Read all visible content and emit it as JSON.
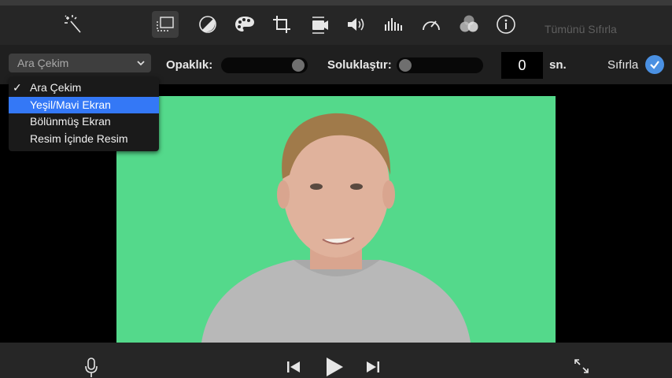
{
  "toolbar": {
    "tools": [
      {
        "name": "magic-wand-icon"
      },
      {
        "name": "video-overlay-icon",
        "active": true
      },
      {
        "name": "color-balance-icon"
      },
      {
        "name": "color-palette-icon"
      },
      {
        "name": "crop-icon"
      },
      {
        "name": "stabilization-icon"
      },
      {
        "name": "volume-icon"
      },
      {
        "name": "equalizer-icon"
      },
      {
        "name": "speedometer-icon"
      },
      {
        "name": "filters-icon"
      },
      {
        "name": "info-icon"
      }
    ],
    "reset_all_label": "Tümünü Sıfırla"
  },
  "controls": {
    "overlay_select_value": "Ara Çekim",
    "opacity_label": "Opaklık:",
    "opacity_level_pct": 100,
    "fade_label": "Soluklaştır:",
    "fade_level_pct": 0,
    "fade_seconds_value": "0",
    "seconds_unit": "sn.",
    "reset_label": "Sıfırla"
  },
  "menu": {
    "items": [
      {
        "label": "Ara Çekim",
        "checked": true
      },
      {
        "label": "Yeşil/Mavi Ekran",
        "highlighted": true
      },
      {
        "label": "Bölünmüş Ekran"
      },
      {
        "label": "Resim İçinde Resim"
      }
    ],
    "checkmark": "✓"
  },
  "colors": {
    "green_screen": "#54d98b",
    "highlight": "#3478f6",
    "accent_check": "#4a90e2",
    "toolbar_bg": "#262626"
  },
  "bottom": {
    "buttons": [
      "microphone-icon",
      "skip-back-icon",
      "play-icon",
      "skip-forward-icon",
      "fullscreen-icon"
    ]
  }
}
